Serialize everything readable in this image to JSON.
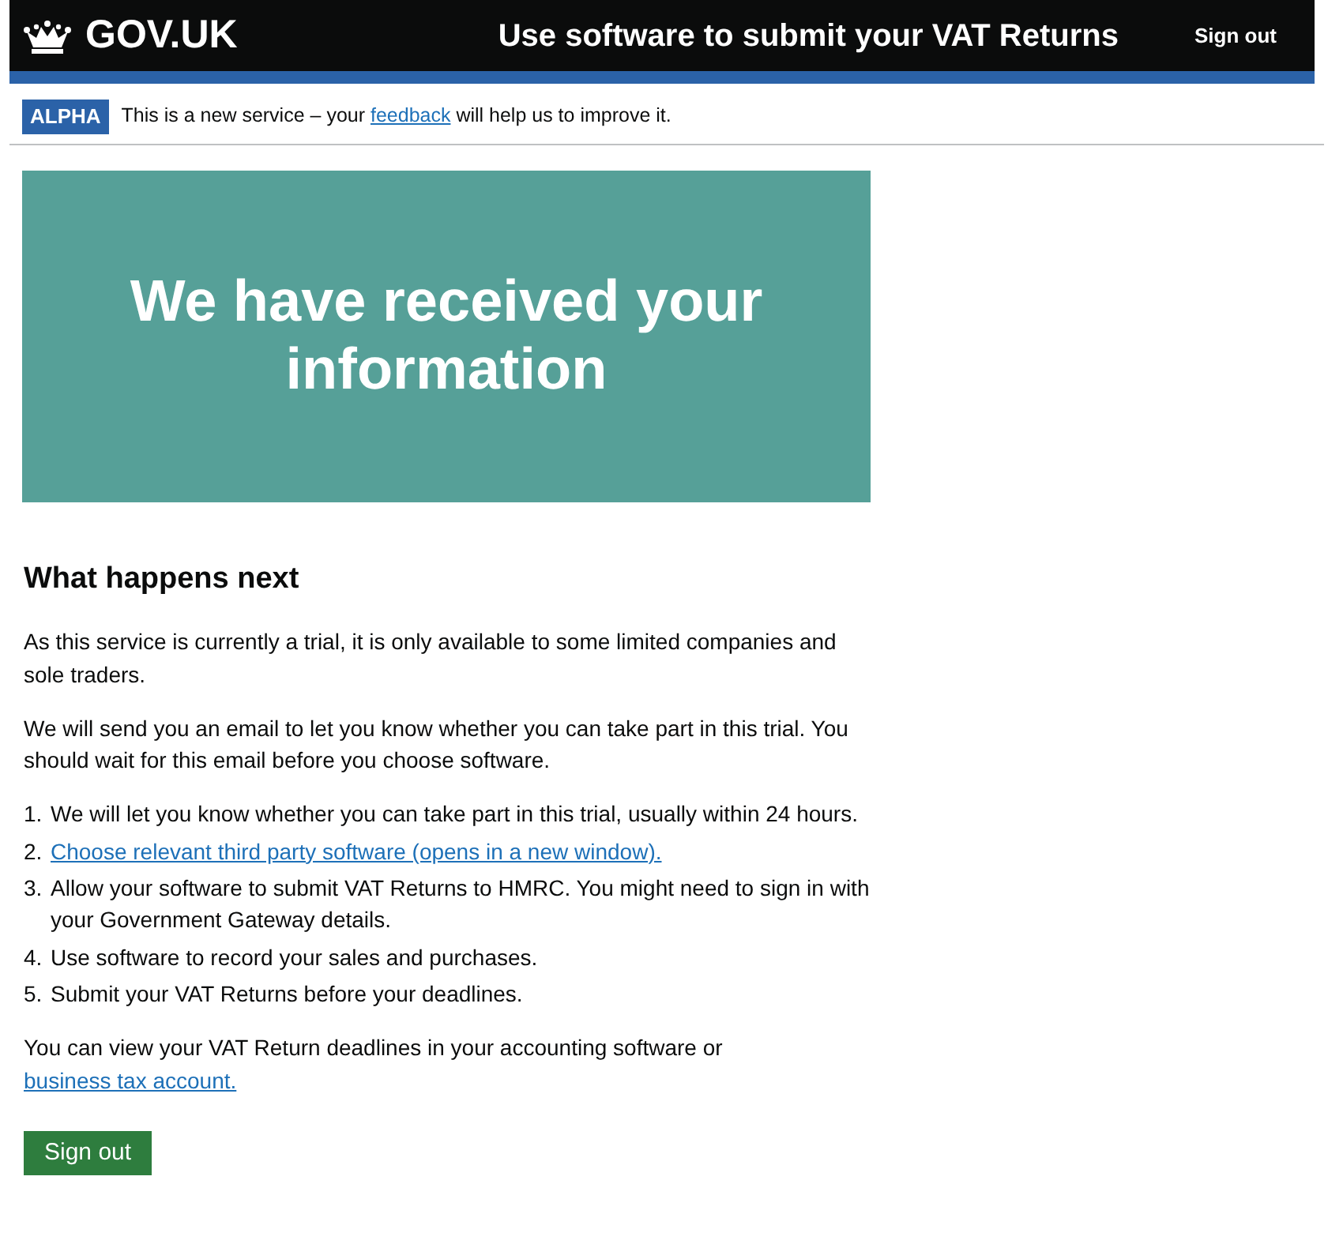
{
  "header": {
    "logo": "GOV.UK",
    "service_name": "Use software to submit your VAT Returns",
    "sign_out": "Sign out"
  },
  "phase_banner": {
    "tag": "ALPHA",
    "text_before": "This is a new service – your",
    "link": "feedback",
    "text_after": "will help us to improve it."
  },
  "panel": {
    "title": "We have received your information"
  },
  "heading": "What happens next",
  "paragraphs": [
    "As this service is currently a trial, it is only available to some limited companies and sole traders.",
    "We will send you an email to let you know whether you can take part in this trial. You should wait for this email before you choose software."
  ],
  "steps": [
    {
      "number": "1.",
      "kind": "text",
      "text": "We will let you know whether you can take part in this trial, usually within 24 hours."
    },
    {
      "number": "2.",
      "kind": "link",
      "text": "Choose relevant third party software (opens in a new window)."
    },
    {
      "number": "3.",
      "kind": "text",
      "text": "Allow your software to submit VAT Returns to HMRC. You might need to sign in with your Government Gateway details."
    },
    {
      "number": "4.",
      "kind": "text",
      "text": "Use software to record your sales and purchases."
    },
    {
      "number": "5.",
      "kind": "text",
      "text": "Submit your VAT Returns before your deadlines."
    }
  ],
  "closing": {
    "text": "You can view your VAT Return deadlines in your accounting software or",
    "link": "business tax account."
  },
  "button": "Sign out"
}
